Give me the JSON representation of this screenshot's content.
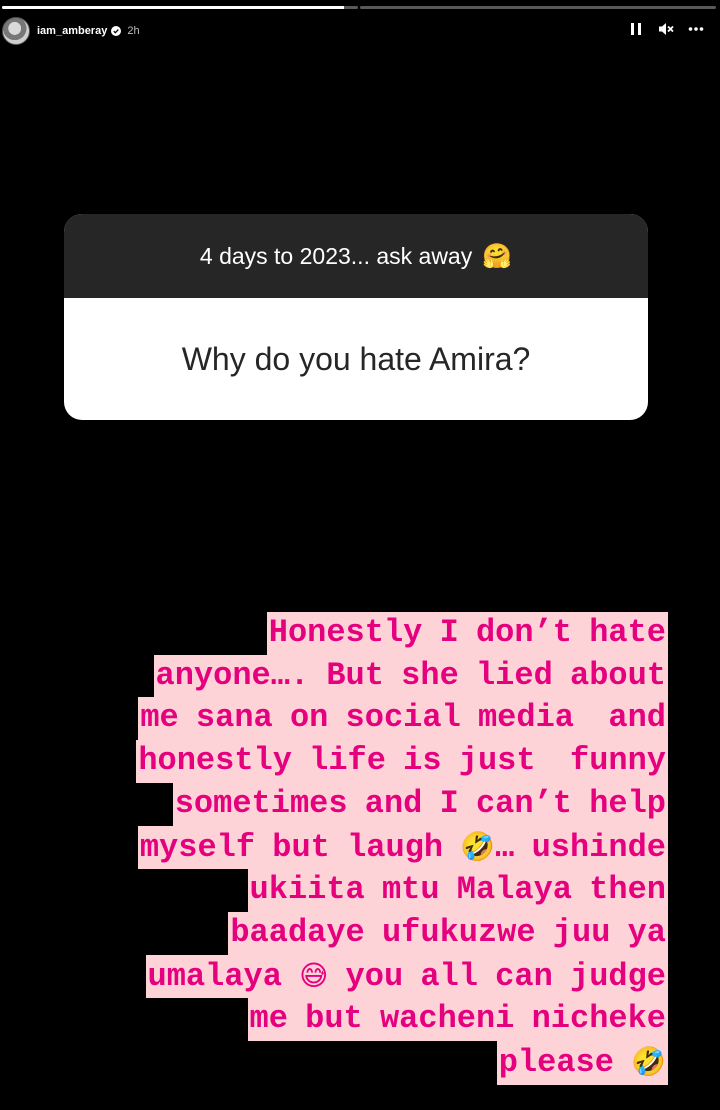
{
  "story": {
    "progress": {
      "segments": 2,
      "current_index": 0,
      "current_fraction": 0.96
    }
  },
  "header": {
    "username": "iam_amberay",
    "time_ago": "2h",
    "icons": [
      "pause-icon",
      "mute-icon",
      "more-icon"
    ]
  },
  "question_sticker": {
    "prompt": "4 days to 2023... ask away",
    "prompt_emoji": "🤗",
    "question": "Why do you hate Amira?"
  },
  "reply": {
    "lines": [
      "Honestly I don’t hate",
      "anyone…. But she lied about",
      "me sana on social media  and",
      "honestly life is just  funny",
      "sometimes and I can’t help",
      "myself but laugh 🤣… ushinde",
      "ukiita mtu Malaya then",
      "baadaye ufukuzwe juu ya",
      "umalaya 😅 you all can judge",
      "me but wacheni nicheke",
      "please 🤣"
    ],
    "text_color": "#e5007e",
    "highlight_color": "#fdd3d8"
  }
}
